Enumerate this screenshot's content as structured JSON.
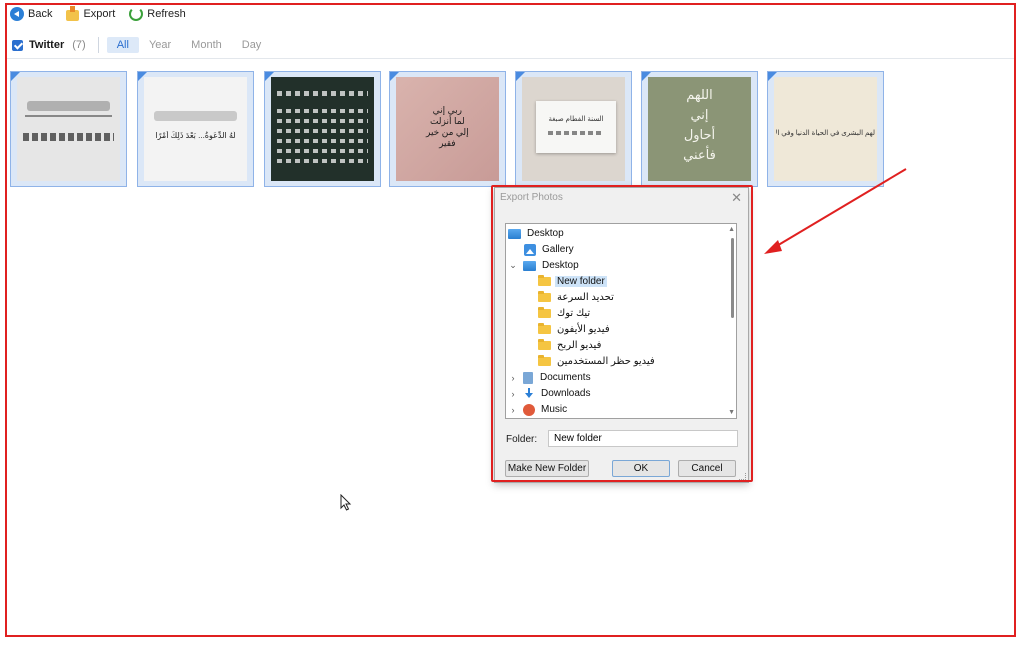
{
  "toolbar": {
    "back": "Back",
    "export": "Export",
    "refresh": "Refresh"
  },
  "filter": {
    "title": "Twitter",
    "count": "(7)",
    "tabs": [
      "All",
      "Year",
      "Month",
      "Day"
    ],
    "active_tab": "All"
  },
  "thumbnails": {
    "t2_text": "لَهُ الدِّعَوةُ... بَعْدَ ذَلِكَ أَمْرًا",
    "t4_lines": [
      "ربي إني",
      "لما أنزلت",
      "إلي من خير",
      "فقير"
    ],
    "t5_text": "السنة الفطام صبغة",
    "t6_lines": [
      "اللهم",
      "إني",
      "أحاول",
      "فأعني"
    ],
    "t7_text": "لهم البشرى في الحياة الدنيا وفي الآخرة"
  },
  "dialog": {
    "title": "Export Photos",
    "tree": [
      {
        "label": "Desktop"
      },
      {
        "label": "Gallery"
      },
      {
        "label": "Desktop"
      },
      {
        "label": "New folder"
      },
      {
        "label": "تحديد السرعة"
      },
      {
        "label": "تيك توك"
      },
      {
        "label": "فيديو الأيفون"
      },
      {
        "label": "فيديو الربح"
      },
      {
        "label": "فيديو حظر المستخدمين"
      },
      {
        "label": "Documents"
      },
      {
        "label": "Downloads"
      },
      {
        "label": "Music"
      }
    ],
    "folder_label": "Folder:",
    "folder_value": "New folder",
    "make_new_folder": "Make New Folder",
    "ok": "OK",
    "cancel": "Cancel"
  },
  "colors": {
    "accent": "#2b6fcf",
    "annotation": "#e02020",
    "selection": "#cde3f8"
  }
}
